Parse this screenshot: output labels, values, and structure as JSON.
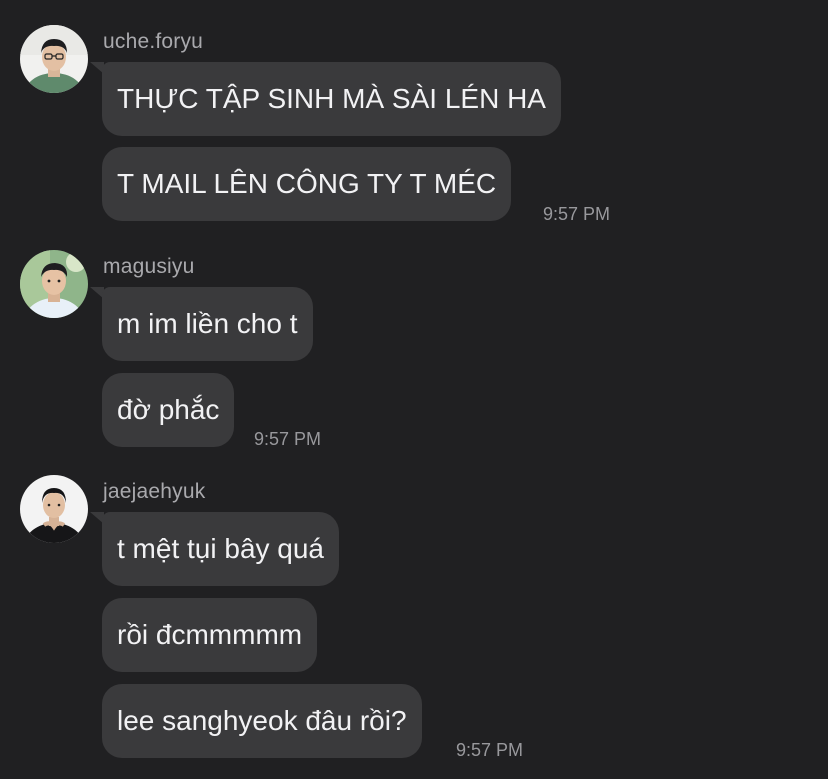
{
  "groups": [
    {
      "username": "uche.foryu",
      "messages": [
        "THỰC TẬP SINH MÀ SÀI LÉN HA",
        "T MAIL LÊN CÔNG TY T MÉC"
      ],
      "time": "9:57 PM"
    },
    {
      "username": "magusiyu",
      "messages": [
        "m im liền cho t",
        "đờ phắc"
      ],
      "time": "9:57 PM"
    },
    {
      "username": "jaejaehyuk",
      "messages": [
        "t mệt tụi bây quá",
        "rồi đcmmmmm",
        "lee sanghyeok đâu rồi?"
      ],
      "time": "9:57 PM"
    }
  ],
  "colors": {
    "background": "#202022",
    "bubble": "#3a3a3c",
    "message_text": "#f2f2f4",
    "username_text": "#a9a9ad",
    "time_text": "#98989c"
  }
}
